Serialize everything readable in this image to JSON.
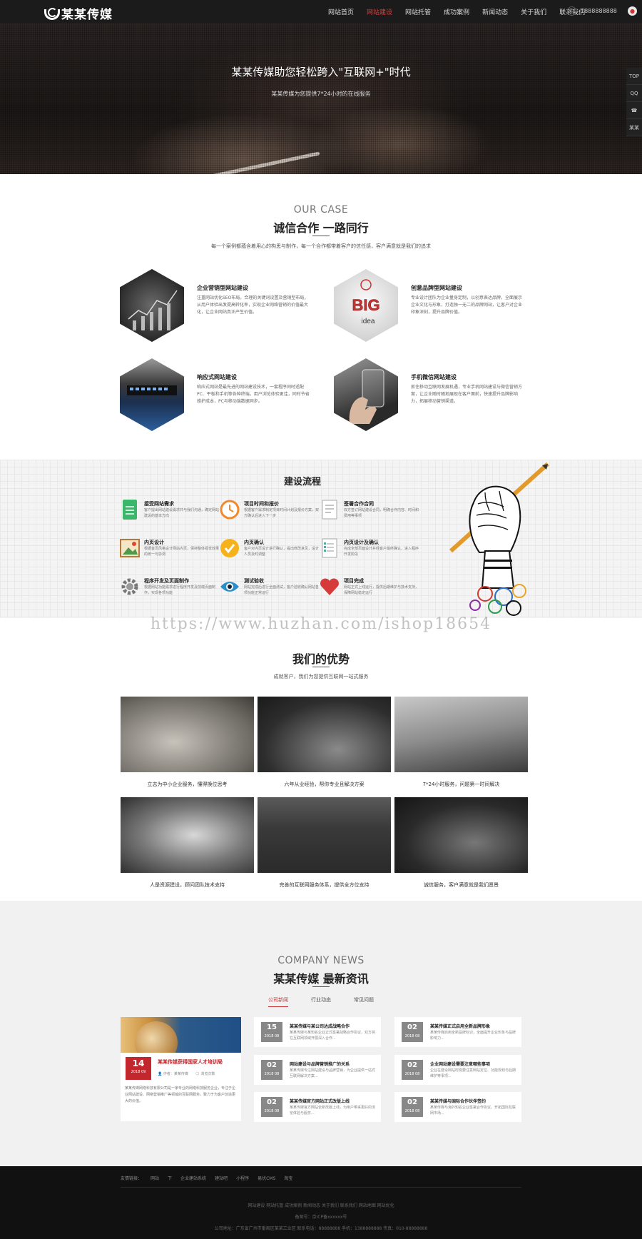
{
  "header": {
    "logo": "某某传媒",
    "nav": [
      "网站首页",
      "网站建设",
      "网站托管",
      "成功案例",
      "新闻动态",
      "关于我们",
      "联系我们"
    ],
    "active_index": 1,
    "phone": "1888888888"
  },
  "banner": {
    "title": "某某传媒助您轻松跨入\"互联网+\"时代",
    "subtitle": "某某传媒为您提供7*24小时的在线服务"
  },
  "side_tools": [
    "TOP",
    "QQ",
    "☎",
    "某某"
  ],
  "case_section": {
    "en": "OUR CASE",
    "cn": "诚信合作  一路同行",
    "sub": "每一个案例都蕴含着用心的构思与制作，每一个合作都带着客户的信任感，客户满意就是我们的追求",
    "items": [
      {
        "title": "企业营销型网站建设",
        "desc": "注重网站优化SEO布局，合理的关键词设置及营销型布局，从用户体验出发提高转化率，实现企业网络营销的价值最大化，让企业网站真正产生价值。"
      },
      {
        "title": "创意品牌型网站建设",
        "desc": "专业设计团队为企业量身定制，以创意表达品牌，全面展示企业文化与形象，打造独一无二的品牌网站，让客户对企业印象深刻，提升品牌价值。"
      },
      {
        "title": "响应式网站建设",
        "desc": "响应式网站是最先进的网站建设技术，一套程序同时适配PC、平板和手机等各种终端，用户浏览体验更佳，同时节省维护成本，PC与移动端数据同步。"
      },
      {
        "title": "手机微信网站建设",
        "desc": "抓住移动互联网发展机遇，专业手机网站建设与微信营销方案，让企业随时随地展现在客户面前，快速提升品牌影响力，拓展移动营销渠道。"
      }
    ]
  },
  "process": {
    "title": "建设流程",
    "items": [
      {
        "name": "接受网站需求",
        "desc": "客户提出网站建设需求并与我们沟通，确定网站建设的基本方向"
      },
      {
        "name": "项目时间和报价",
        "desc": "根据客户需求制定项目时间计划及报价方案，双方确认后进入下一步"
      },
      {
        "name": "签署合作合同",
        "desc": "双方签订网站建设合同，明确合作内容、时间和费用等事项"
      },
      {
        "name": "内页设计",
        "desc": "根据首页风格设计网站内页，保持整体视觉效果的统一与协调"
      },
      {
        "name": "内页确认",
        "desc": "客户对内页设计进行确认，提出修改意见，设计人员及时调整"
      },
      {
        "name": "内页设计及确认",
        "desc": "完成全部页面设计并经客户最终确认，进入程序开发阶段"
      },
      {
        "name": "程序开发及页面制作",
        "desc": "根据网站功能需求进行程序开发及前端页面制作，实现各项功能"
      },
      {
        "name": "测试验收",
        "desc": "网站完成后进行全面测试，客户验收确认网站各项功能正常运行"
      },
      {
        "name": "项目完成",
        "desc": "网站正式上线运行，提供后期维护与技术支持，保障网站稳定运行"
      }
    ]
  },
  "watermark": "https://www.huzhan.com/ishop18654",
  "advantages": {
    "title": "我们的优势",
    "sub": "成就客户，我们为您提供互联网一站式服务",
    "items": [
      "立志为中小企业服务，懂得换位思考",
      "六年从业经验，帮你专业且解决方案",
      "7*24小时服务，问题第一时间解决",
      "人是资源建设，顾问团队技术支持",
      "完善的互联网服务体系，提供全方位支持",
      "诚信服务，客户满意就是我们愿景"
    ]
  },
  "news": {
    "en": "COMPANY NEWS",
    "cn": "某某传媒  最新资讯",
    "tabs": [
      "公司新闻",
      "行业动态",
      "常见问题"
    ],
    "active_tab": 0,
    "featured": {
      "day": "14",
      "ym": "2018 09",
      "title": "某某传媒获得国家人才培训局",
      "author": "作者：某某传媒",
      "views": "浏览次数",
      "text": "某某传媒网络科技有限公司是一家专业的网络科技服务企业，专注于企业网站建设、网络营销推广等领域的互联网服务，致力于为客户创造更大的价值。"
    },
    "left_col": [
      {
        "day": "15",
        "ym": "2018 08",
        "title": "某某传媒与某公司达成战略合作",
        "text": "某某传媒与某知名企业正式签署战略合作协议，双方将在互联网领域开展深入合作..."
      },
      {
        "day": "02",
        "ym": "2018 08",
        "title": "网站建设与品牌营销推广的关系",
        "text": "某某传媒专注网站建设与品牌营销，为企业提供一站式互联网解决方案..."
      },
      {
        "day": "02",
        "ym": "2018 08",
        "title": "某某传媒官方网站正式改版上线",
        "text": "某某传媒官方网站全新改版上线，为用户带来更好的浏览体验与服务..."
      }
    ],
    "right_col": [
      {
        "day": "02",
        "ym": "2018 08",
        "title": "某某传媒正式启用全新品牌形象",
        "text": "某某传媒启用全新品牌标识，全面提升企业形象与品牌影响力..."
      },
      {
        "day": "02",
        "ym": "2018 08",
        "title": "企业网站建设需要注意哪些事项",
        "text": "企业在建设网站时需要注意网站定位、功能规划与后期维护等事项..."
      },
      {
        "day": "02",
        "ym": "2018 08",
        "title": "某某传媒与国际合作伙伴签约",
        "text": "某某传媒与海外知名企业签署合作协议，开拓国际互联网市场..."
      }
    ]
  },
  "footer": {
    "links_label": "友情链接：",
    "links": [
      "网站",
      "下",
      "企业建站系统",
      "建站吧",
      "小程序",
      "易优CMS",
      "淘宝"
    ],
    "row1": "网站建设 网站托管 成功案例 新闻动态 关于我们 联系我们 网站地图 网站优化",
    "row2": "备案号：京ICP备xxxxxx号",
    "row3": "公司地址：广东省广州市番禺区某某工业区   联系电话：88888888   手机：1388888888   传真：010-88888888"
  }
}
